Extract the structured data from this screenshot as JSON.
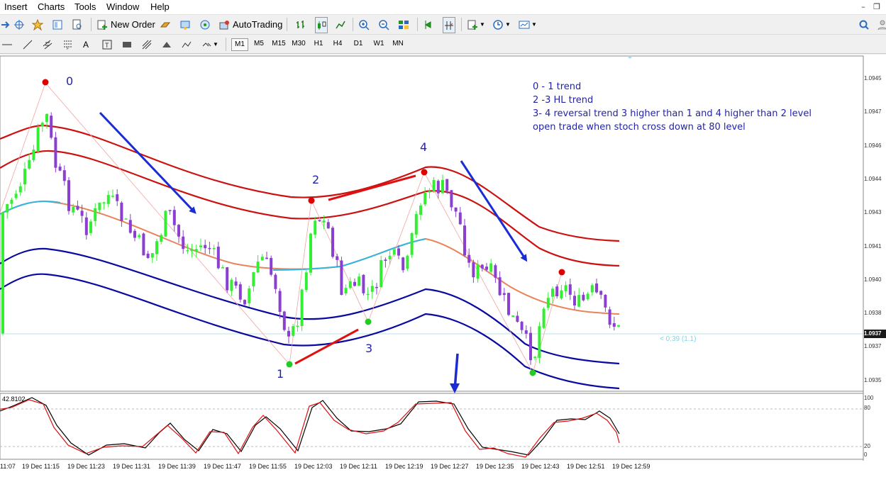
{
  "menu": [
    "Insert",
    "Charts",
    "Tools",
    "Window",
    "Help"
  ],
  "toolbar": {
    "new_order_label": "New Order",
    "autotrading_label": "AutoTrading"
  },
  "timeframes": [
    "M1",
    "M5",
    "M15",
    "M30",
    "H1",
    "H4",
    "D1",
    "W1",
    "MN"
  ],
  "active_timeframe": "M1",
  "price_axis": [
    "1.0945",
    "1.0947",
    "1.0946",
    "1.0944",
    "1.0943",
    "1.0941",
    "1.0940",
    "1.0938",
    "1.0937",
    "1.0937",
    "1.0935"
  ],
  "current_price_label": "1.0937",
  "countdown_label": "< 0:39 (1.1)",
  "time_axis": [
    "11:07",
    "19 Dec 11:15",
    "19 Dec 11:23",
    "19 Dec 11:31",
    "19 Dec 11:39",
    "19 Dec 11:47",
    "19 Dec 11:55",
    "19 Dec 12:03",
    "19 Dec 12:11",
    "19 Dec 12:19",
    "19 Dec 12:27",
    "19 Dec 12:35",
    "19 Dec 12:43",
    "19 Dec 12:51",
    "19 Dec 12:59"
  ],
  "stoch": {
    "value_label": "42.8102",
    "levels": [
      "100",
      "80",
      "20",
      "0"
    ]
  },
  "annotations": {
    "wave_labels": [
      "0",
      "1",
      "2",
      "3",
      "4"
    ],
    "notes": [
      "0 - 1 trend",
      "2 -3  HL trend",
      "3- 4 reversal trend 3 higher than 1 and 4 higher than 2 level",
      "open trade when stoch cross down at 80 level"
    ]
  },
  "colors": {
    "bull_candle": "#33ee33",
    "bear_candle": "#8a3fd1",
    "upper_band": "#cc1111",
    "lower_band": "#0a0aa0",
    "midline_low": "#e8835a",
    "midline_high": "#33b6e0",
    "arrow": "#1a2cd6",
    "stoch_main": "#000000",
    "stoch_signal": "#dd1111"
  }
}
